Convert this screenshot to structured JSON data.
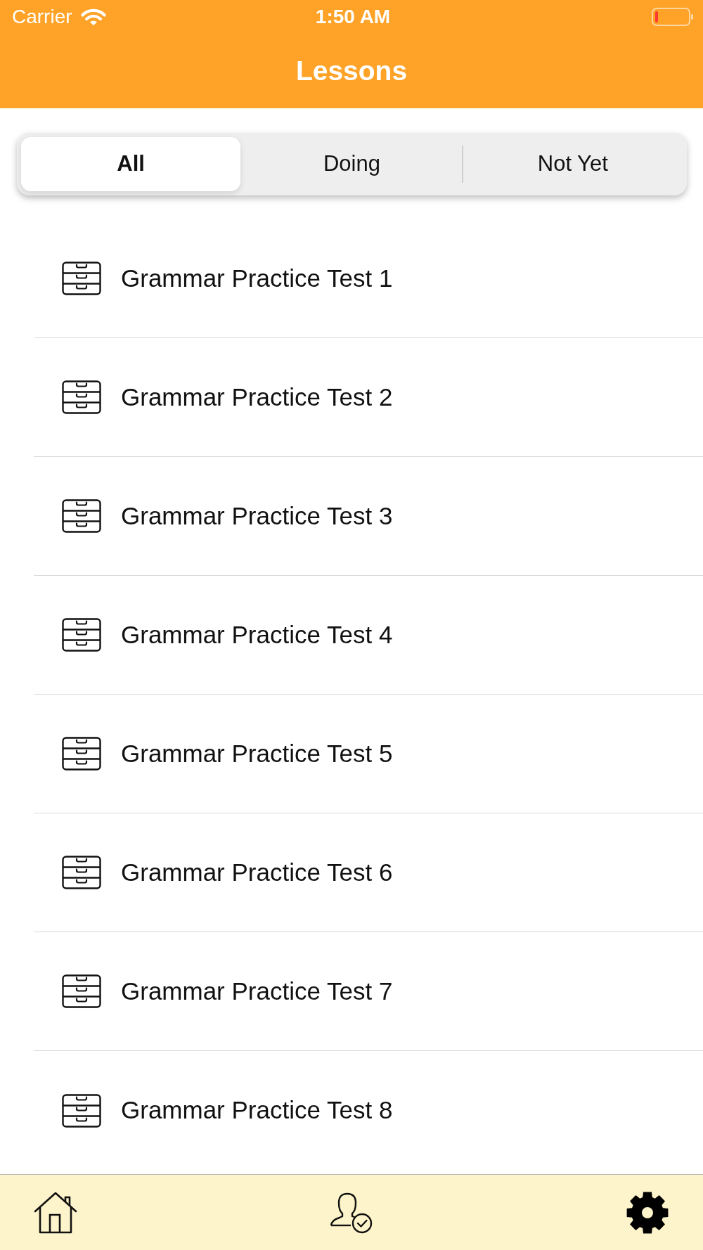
{
  "status_bar": {
    "carrier": "Carrier",
    "time": "1:50 AM"
  },
  "nav_bar": {
    "title": "Lessons"
  },
  "segments": [
    {
      "label": "All",
      "selected": true
    },
    {
      "label": "Doing",
      "selected": false
    },
    {
      "label": "Not Yet",
      "selected": false
    }
  ],
  "lessons": [
    {
      "title": "Grammar Practice Test 1"
    },
    {
      "title": "Grammar Practice Test 2"
    },
    {
      "title": "Grammar Practice Test 3"
    },
    {
      "title": "Grammar Practice Test 4"
    },
    {
      "title": "Grammar Practice Test 5"
    },
    {
      "title": "Grammar Practice Test 6"
    },
    {
      "title": "Grammar Practice Test 7"
    },
    {
      "title": "Grammar Practice Test 8"
    }
  ]
}
